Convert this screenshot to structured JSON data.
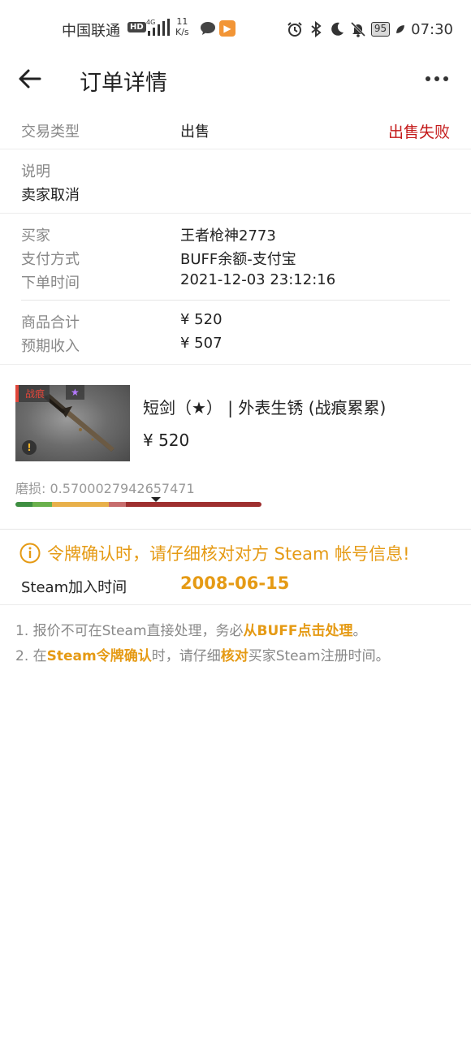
{
  "status_bar": {
    "carrier": "中国联通",
    "hd": "HD",
    "network": "4G",
    "speed_value": "11",
    "speed_unit": "K/s",
    "battery": "95",
    "time": "07:30"
  },
  "header": {
    "title": "订单详情"
  },
  "order": {
    "type_label": "交易类型",
    "type_value": "出售",
    "status": "出售失败",
    "desc_label": "说明",
    "desc_value": "卖家取消",
    "buyer_label": "买家",
    "buyer_value": "王者枪神2773",
    "payment_label": "支付方式",
    "payment_value": "BUFF余额-支付宝",
    "time_label": "下单时间",
    "time_value": "2021-12-03 23:12:16",
    "total_label": "商品合计",
    "total_value": "¥ 520",
    "income_label": "预期收入",
    "income_value": "¥ 507"
  },
  "item": {
    "wear_tag": "战痕",
    "star_tag": "★",
    "warn_badge": "!",
    "name": "短剑（★） | 外表生锈 (战痕累累)",
    "price": "¥ 520",
    "float_label": "磨损:",
    "float_value": "0.5700027942657471",
    "float_fraction": 0.57,
    "wear_colors": [
      "#3e8e41",
      "#6ab04c",
      "#e8b04a",
      "#c76d6d",
      "#9e2f2f"
    ]
  },
  "steam": {
    "warning": "令牌确认时，请仔细核对对方 Steam 帐号信息!",
    "join_label": "Steam加入时间",
    "join_date": "2008-06-15"
  },
  "notes": {
    "n1_a": "1. 报价不可在Steam直接处理，务必",
    "n1_hl": "从BUFF点击处理",
    "n1_b": "。",
    "n2_a": "2. 在",
    "n2_hl1": "Steam令牌确认",
    "n2_b": "时，请仔细",
    "n2_hl2": "核对",
    "n2_c": "买家Steam注册时间。"
  },
  "colors": {
    "accent": "#e59a14",
    "fail": "#c41a1a"
  }
}
